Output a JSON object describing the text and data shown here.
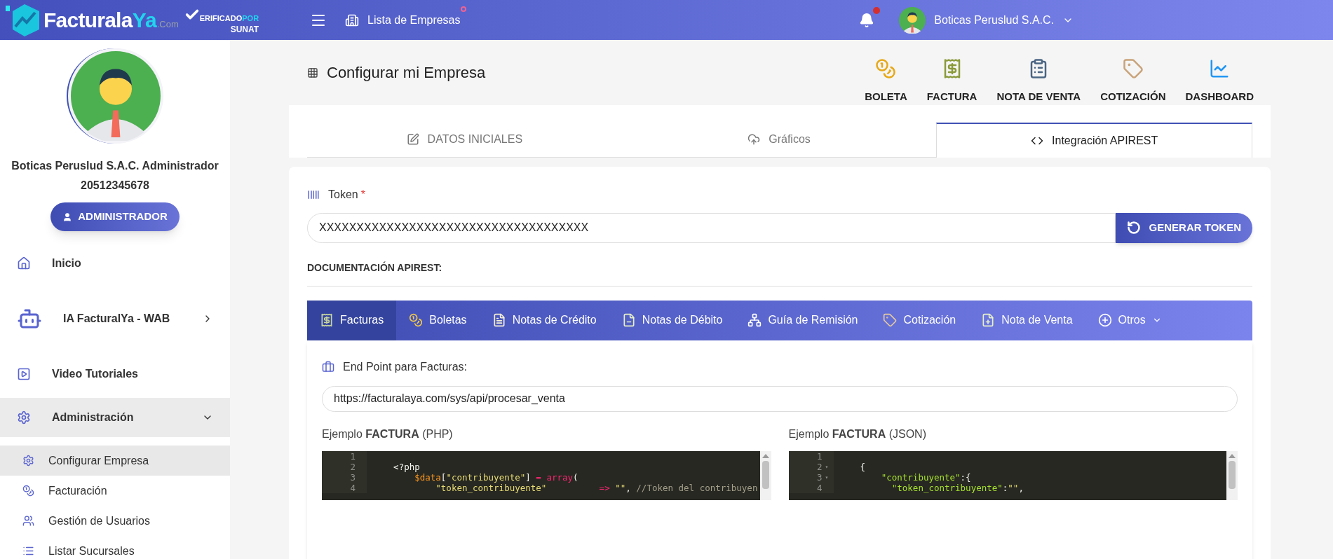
{
  "topbar": {
    "logo": {
      "name": "Facturala",
      "accent": "Ya",
      "suffix": ".Com"
    },
    "verified": {
      "line1": "ERIFICADO",
      "accent": "POR",
      "line2": "SUNAT"
    },
    "companies_link": {
      "label": "Lista de Empresas",
      "badge": true
    },
    "notifications": {
      "unread": true
    },
    "user": {
      "name": "Boticas Peruslud S.A.C."
    }
  },
  "sidebar": {
    "profile": {
      "name": "Boticas Peruslud S.A.C. Administrador",
      "ruc": "20512345678",
      "role": "ADMINISTRADOR"
    },
    "items": [
      {
        "label": "Inicio"
      },
      {
        "label": "IA FacturalYa - WAB",
        "expanded": false
      },
      {
        "label": "Video Tutoriales"
      },
      {
        "label": "Administración",
        "expanded": true,
        "children": [
          {
            "label": "Configurar Empresa",
            "selected": true
          },
          {
            "label": "Facturación",
            "selected": false
          },
          {
            "label": "Gestión de Usuarios",
            "selected": false
          },
          {
            "label": "Listar Sucursales",
            "selected": false
          }
        ]
      }
    ]
  },
  "page": {
    "title": "Configurar mi Empresa",
    "shortcuts": [
      "BOLETA",
      "FACTURA",
      "NOTA DE VENTA",
      "COTIZACIÓN",
      "DASHBOARD"
    ],
    "tabs": [
      {
        "label": "DATOS INICIALES",
        "selected": false
      },
      {
        "label": "Gráficos",
        "selected": false
      },
      {
        "label": "Integración APIREST",
        "selected": true
      }
    ]
  },
  "token": {
    "label": "Token",
    "required_mark": "*",
    "value": "XXXXXXXXXXXXXXXXXXXXXXXXXXXXXXXXXXXX",
    "button": "GENERAR TOKEN"
  },
  "docs": {
    "heading": "DOCUMENTACIÓN APIREST:",
    "tabs": [
      {
        "label": "Facturas",
        "selected": true,
        "dropdown": false
      },
      {
        "label": "Boletas",
        "selected": false,
        "dropdown": false
      },
      {
        "label": "Notas de Crédito",
        "selected": false,
        "dropdown": false
      },
      {
        "label": "Notas de Débito",
        "selected": false,
        "dropdown": false
      },
      {
        "label": "Guía de Remisión",
        "selected": false,
        "dropdown": false
      },
      {
        "label": "Cotización",
        "selected": false,
        "dropdown": false
      },
      {
        "label": "Nota de Venta",
        "selected": false,
        "dropdown": false
      },
      {
        "label": "Otros",
        "selected": false,
        "dropdown": true
      }
    ],
    "endpoint": {
      "label": "End Point para Facturas:",
      "value": "https://facturalaya.com/sys/api/procesar_venta"
    },
    "examples": [
      {
        "title": "Ejemplo **FACTURA** (PHP)",
        "lines": [
          {
            "number": "1"
          },
          {
            "number": "2",
            "segments": [
              {
                "kind": "plain",
                "text": "    <?php"
              }
            ]
          },
          {
            "number": "3",
            "segments": [
              {
                "kind": "variable",
                "text": "        $data"
              },
              {
                "kind": "plain",
                "text": "["
              },
              {
                "kind": "string",
                "text": "\"contribuyente\""
              },
              {
                "kind": "plain",
                "text": "] "
              },
              {
                "kind": "keyword",
                "text": "= array"
              },
              {
                "kind": "plain",
                "text": "("
              }
            ]
          },
          {
            "number": "4",
            "segments": [
              {
                "kind": "string",
                "text": "            \"token_contribuyente\""
              },
              {
                "kind": "keyword",
                "text": "          => "
              },
              {
                "kind": "string",
                "text": "\"\""
              },
              {
                "kind": "plain",
                "text": ", "
              },
              {
                "kind": "comment",
                "text": "//Token del contribuyen"
              }
            ]
          }
        ]
      },
      {
        "title": "Ejemplo **FACTURA** (JSON)",
        "lines": [
          {
            "number": "1"
          },
          {
            "number": "2",
            "fold": "▾",
            "segments": [
              {
                "kind": "plain",
                "text": "    {"
              }
            ]
          },
          {
            "number": "3",
            "fold": "▾",
            "segments": [
              {
                "kind": "key",
                "text": "        \"contribuyente\""
              },
              {
                "kind": "plain",
                "text": ":{"
              }
            ]
          },
          {
            "number": "4",
            "segments": [
              {
                "kind": "key",
                "text": "          \"token_contribuyente\""
              },
              {
                "kind": "plain",
                "text": ":"
              },
              {
                "kind": "string",
                "text": "\"\""
              },
              {
                "kind": "plain",
                "text": ","
              }
            ]
          }
        ]
      }
    ]
  }
}
